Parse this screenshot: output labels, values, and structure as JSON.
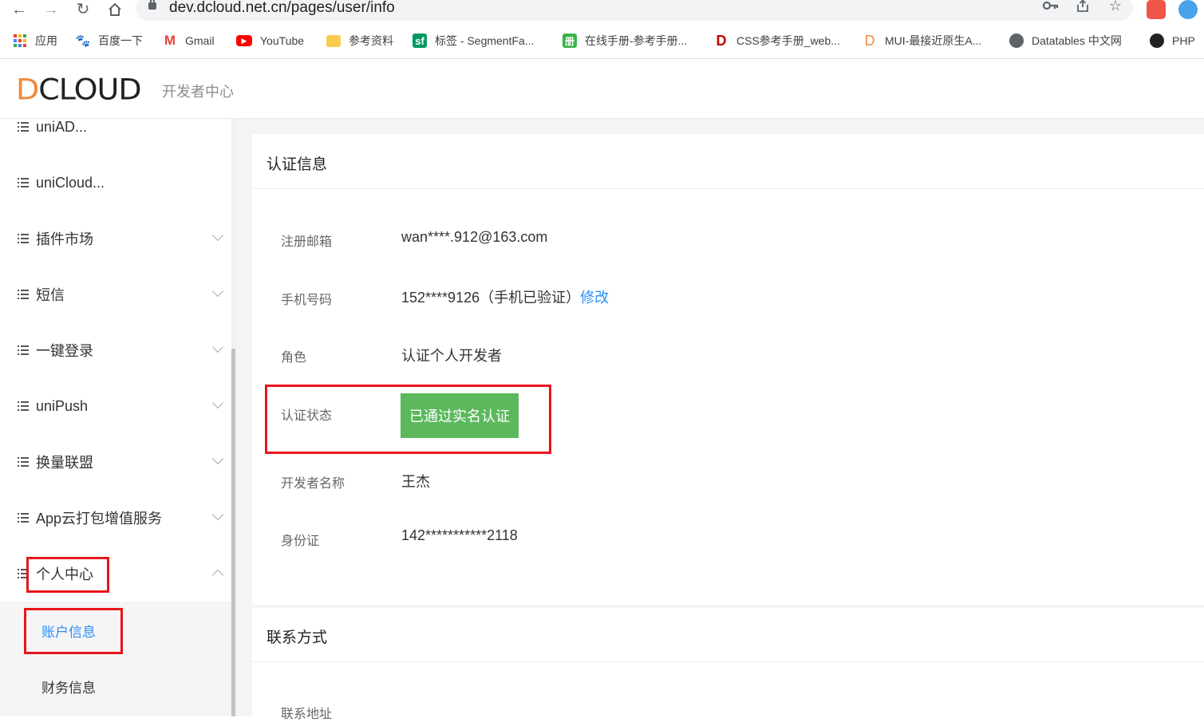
{
  "browser": {
    "url": "dev.dcloud.net.cn/pages/user/info",
    "bookmarks": [
      {
        "label": "应用",
        "icon": "apps-grid-icon"
      },
      {
        "label": "百度一下",
        "icon": "baidu-paw-icon"
      },
      {
        "label": "Gmail",
        "icon": "gmail-icon"
      },
      {
        "label": "YouTube",
        "icon": "youtube-icon"
      },
      {
        "label": "参考资料",
        "icon": "folder-icon"
      },
      {
        "label": "标签 - SegmentFa...",
        "icon": "segmentfault-icon"
      },
      {
        "label": "在线手册-参考手册...",
        "icon": "manual-icon"
      },
      {
        "label": "CSS参考手册_web...",
        "icon": "css-manual-icon"
      },
      {
        "label": "MUI-最接近原生A...",
        "icon": "dcloud-d-icon"
      },
      {
        "label": "Datatables 中文网",
        "icon": "globe-icon"
      },
      {
        "label": "PHP",
        "icon": "php-icon"
      }
    ]
  },
  "header": {
    "logo_text": "CLOUD",
    "logo_letter": "D",
    "subtitle": "开发者中心"
  },
  "sidebar": {
    "items": [
      {
        "label": "uniAD...",
        "expandable": false
      },
      {
        "label": "uniCloud...",
        "expandable": false
      },
      {
        "label": "插件市场",
        "expandable": true
      },
      {
        "label": "短信",
        "expandable": true
      },
      {
        "label": "一键登录",
        "expandable": true
      },
      {
        "label": "uniPush",
        "expandable": true
      },
      {
        "label": "换量联盟",
        "expandable": true
      },
      {
        "label": "App云打包增值服务",
        "expandable": true
      },
      {
        "label": "个人中心",
        "expandable": true,
        "expanded": true
      }
    ],
    "sub_items": [
      {
        "label": "账户信息",
        "active": true
      },
      {
        "label": "财务信息",
        "active": false
      }
    ]
  },
  "auth_card": {
    "title": "认证信息",
    "rows": [
      {
        "label": "注册邮箱",
        "value": "wan****.912@163.com"
      },
      {
        "label": "手机号码",
        "value": "152****9126（手机已验证）",
        "link": "修改"
      },
      {
        "label": "角色",
        "value": "认证个人开发者"
      },
      {
        "label": "认证状态",
        "badge": "已通过实名认证"
      },
      {
        "label": "开发者名称",
        "value": "王杰"
      },
      {
        "label": "身份证",
        "value": "142***********2118"
      }
    ]
  },
  "contact_card": {
    "title": "联系方式",
    "rows": [
      {
        "label": "联系地址"
      }
    ]
  },
  "colors": {
    "accent_blue": "#2a8ff7",
    "verified_green": "#5cb85c",
    "highlight_red": "#e8151d",
    "logo_orange": "#f08a3b"
  }
}
